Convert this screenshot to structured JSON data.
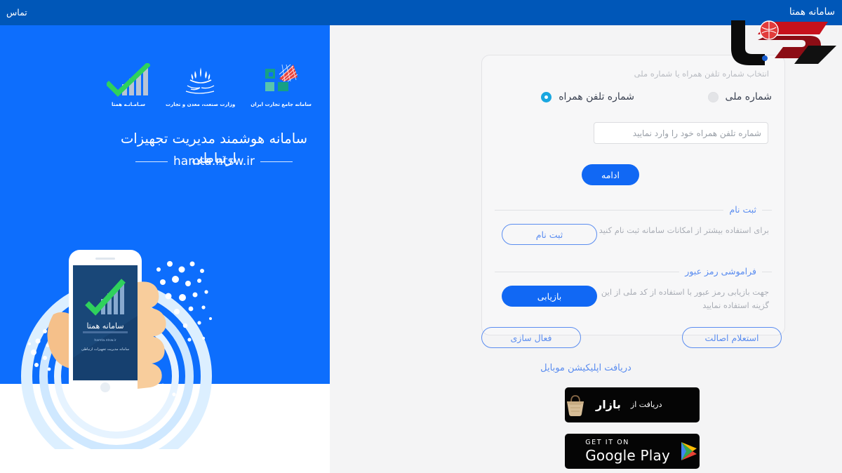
{
  "header": {
    "contact_link": "تماس",
    "brand": "سامانه همتا",
    "watermark_icon": "rokna-watermark-logo",
    "bg_color": "#0057b8"
  },
  "left_panel": {
    "bg_color": "#0d6efd",
    "logos": [
      {
        "icon": "hamta-chart-logo",
        "caption": "سـامـانـه همتا"
      },
      {
        "icon": "iran-ministry-emblem-logo",
        "caption": "وزارت صنعت، معدن و تجارت"
      },
      {
        "icon": "ntsw-trade-system-logo",
        "caption": "سامانه جامع تجارت ایران"
      }
    ],
    "title": "سامانه هوشمند مدیریت تجهیزات ارتباطی",
    "url": "hamta.ntsw.ir",
    "illustration": "hand-holding-phone-illustration",
    "phone_screen": {
      "app_name": "سامانه همتا",
      "app_url": "hamta.ntsw.ir",
      "app_tagline": "سامانه هوشمند مدیریت تجهیزات ارتباطی"
    }
  },
  "login_card": {
    "hint": "انتخاب شماره تلفن همراه یا شماره ملی",
    "radio_options": [
      {
        "label": "شماره ملی",
        "selected": false
      },
      {
        "label": "شماره تلفن همراه",
        "selected": true
      }
    ],
    "phone_input": {
      "value": "",
      "placeholder": "شماره تلفن همراه خود را وارد نمایید"
    },
    "continue_button": "ادامه",
    "register_section": {
      "legend": "ثبت نام",
      "description": "برای استفاده بیشتر از امکانات سامانه ثبت نام کنید",
      "button": "ثبت نام"
    },
    "forgot_section": {
      "legend": "فراموشی رمز عبور",
      "description": "جهت بازیابی رمز عبور با استفاده از کد ملی از این گزینه استفاده نمایید",
      "button": "بازیابی"
    }
  },
  "actions": {
    "authenticity_button": "استعلام اصالت",
    "activation_button": "فعال سازی"
  },
  "app_download": {
    "label": "دریافت اپلیکیشن موبایل",
    "bazaar": {
      "prefix": "دریافت از",
      "name": "بازار",
      "icon": "bazaar-basket-icon"
    },
    "google_play": {
      "small": "GET IT ON",
      "big": "Google Play",
      "icon": "google-play-triangle-icon"
    }
  },
  "colors": {
    "header_blue": "#0057b8",
    "panel_blue": "#0d6efd",
    "accent_blue": "#1168f4",
    "link_blue": "#5b8df0",
    "radio_on": "#1aa7e0",
    "page_bg": "#f4f4f5"
  }
}
